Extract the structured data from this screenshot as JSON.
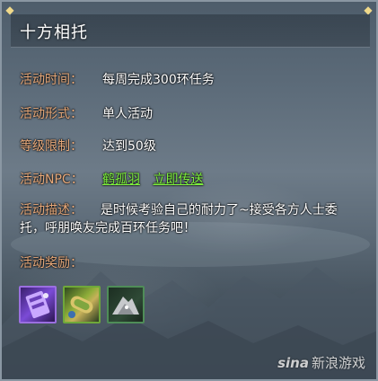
{
  "window": {
    "title": "十方相托"
  },
  "rows": [
    {
      "label": "活动时间：",
      "value": "每周完成300环任务"
    },
    {
      "label": "活动形式：",
      "value": "单人活动"
    },
    {
      "label": "等级限制：",
      "value": "达到50级"
    }
  ],
  "npc": {
    "label": "活动NPC：",
    "name": "鹤孤羽",
    "teleport": "立即传送"
  },
  "description": {
    "label": "活动描述：",
    "text": "是时候考验自己的耐力了~接受各方人士委托，呼朋唤友完成百环任务吧！"
  },
  "rewards": {
    "label": "活动奖励：",
    "items": [
      {
        "icon": "purple-scroll-icon"
      },
      {
        "icon": "gold-scroll-icon"
      },
      {
        "icon": "silver-ore-icon"
      }
    ]
  },
  "watermark": {
    "brand": "sina",
    "text": "新浪游戏"
  },
  "colors": {
    "label": "#e8a97a",
    "value": "#ffffff",
    "link": "#7ef23c",
    "title": "#ffffff"
  }
}
